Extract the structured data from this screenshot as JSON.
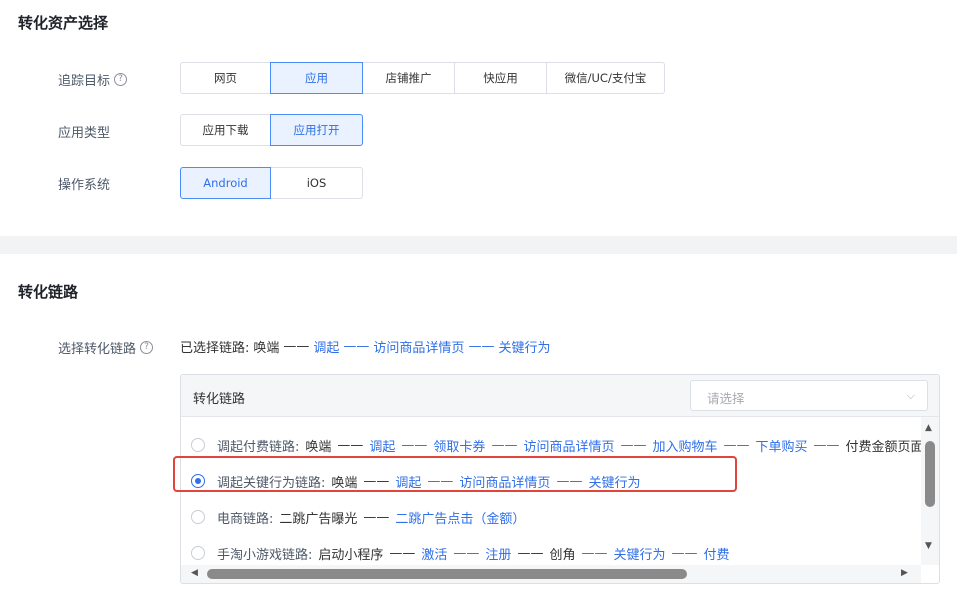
{
  "asset_section": {
    "title": "转化资产选择",
    "rows": [
      {
        "label": "追踪目标",
        "help": "?",
        "options": [
          "网页",
          "应用",
          "店铺推广",
          "快应用",
          "微信/UC/支付宝"
        ],
        "selected": "应用"
      },
      {
        "label": "应用类型",
        "options": [
          "应用下载",
          "应用打开"
        ],
        "selected": "应用打开"
      },
      {
        "label": "操作系统",
        "options": [
          "Android",
          "iOS"
        ],
        "selected": "Android"
      }
    ]
  },
  "chain_section": {
    "title": "转化链路",
    "select_label": "选择转化链路",
    "help": "?",
    "chosen_prefix": "已选择链路:",
    "chosen_steps": [
      "唤端",
      "调起",
      "访问商品详情页",
      "关键行为"
    ],
    "separator": "——",
    "panel": {
      "header_label": "转化链路",
      "select_placeholder": "请选择",
      "items": [
        {
          "name": "调起付费链路:",
          "checked": false,
          "steps": [
            "唤端",
            "调起",
            "领取卡券",
            "访问商品详情页",
            "加入购物车",
            "下单购买",
            "付费金额页面"
          ]
        },
        {
          "name": "调起关键行为链路:",
          "checked": true,
          "steps": [
            "唤端",
            "调起",
            "访问商品详情页",
            "关键行为"
          ]
        },
        {
          "name": "电商链路:",
          "checked": false,
          "steps": [
            "二跳广告曝光",
            "二跳广告点击（金额）"
          ]
        },
        {
          "name": "手淘小游戏链路:",
          "checked": false,
          "steps": [
            "启动小程序",
            "激活",
            "注册",
            "创角",
            "关键行为",
            "付费"
          ]
        }
      ]
    }
  },
  "icons": {
    "help": "question-circle-icon",
    "chevron": "chevron-down-icon"
  },
  "colors": {
    "accent": "#2f6fe8",
    "highlight": "#e0443a"
  }
}
